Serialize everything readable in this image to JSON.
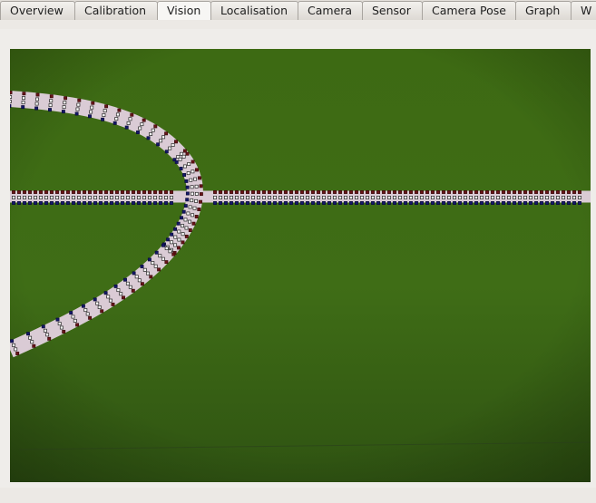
{
  "tabs": [
    {
      "label": "Overview",
      "active": false
    },
    {
      "label": "Calibration",
      "active": false
    },
    {
      "label": "Vision",
      "active": true
    },
    {
      "label": "Localisation",
      "active": false
    },
    {
      "label": "Camera",
      "active": false
    },
    {
      "label": "Sensor",
      "active": false
    },
    {
      "label": "Camera Pose",
      "active": false
    },
    {
      "label": "Graph",
      "active": false
    },
    {
      "label": "W",
      "active": false
    }
  ],
  "colors": {
    "field_green": "#3f6b12",
    "line_white": "#d9c6d2",
    "marker_dark_red": "#6a1418",
    "marker_white": "#ffffff",
    "marker_navy": "#14186a"
  }
}
